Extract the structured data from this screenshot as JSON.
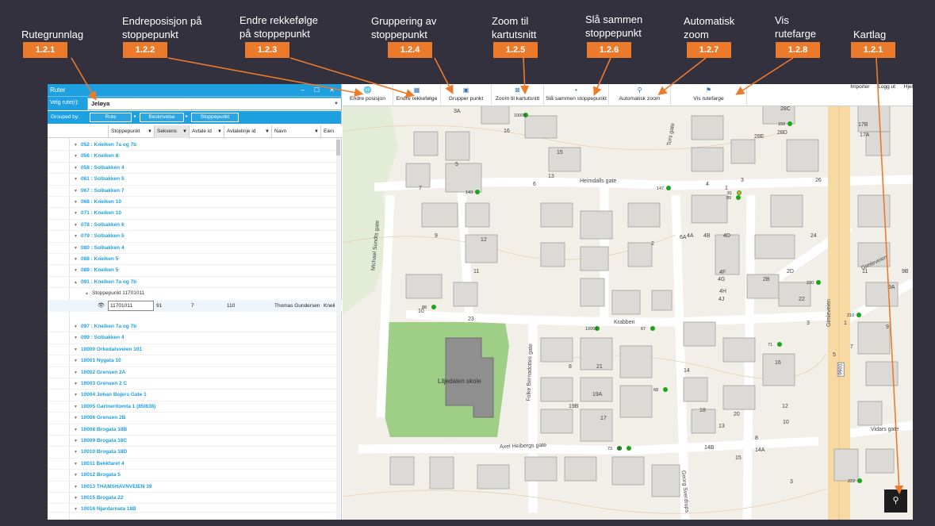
{
  "callouts": [
    {
      "title": "Rutegrunnlag",
      "code": "1.2.1"
    },
    {
      "title": "Endreposisjon på stoppepunkt",
      "code": "1.2.2"
    },
    {
      "title": "Endre rekkefølge på stoppepunkt",
      "code": "1.2.3"
    },
    {
      "title": "Gruppering av stoppepunkt",
      "code": "1.2.4"
    },
    {
      "title": "Zoom til kartutsnitt",
      "code": "1.2.5"
    },
    {
      "title": "Slå sammen stoppepunkt",
      "code": "1.2.6"
    },
    {
      "title": "Automatisk zoom",
      "code": "1.2.7"
    },
    {
      "title": "Vis rutefarge",
      "code": "1.2.8"
    },
    {
      "title": "Kartlag",
      "code": "1.2.1"
    }
  ],
  "panel": {
    "title": "Ruter",
    "window_controls": "– ☐ ✕",
    "route_label": "Velg rute(r):",
    "route_value": "Jeløya",
    "grouped_by_label": "Grouped by:",
    "group_chips": [
      "Rute",
      "Beskrivelse",
      "Stoppepunkt"
    ],
    "columns": [
      "Stoppepunkt",
      "Sekvens",
      "Avtale id",
      "Avtalelinje id",
      "Navn",
      "Eien"
    ],
    "rows_top": [
      "052 : Kneiken 7a og 7b",
      "056 : Kneiken 8",
      "058 : Solbakken 4",
      "061 : Solbakken 5",
      "067 : Solbakken 7",
      "068 : Kneiken 10",
      "071 : Kneiken 10",
      "078 : Solbakken 6",
      "079 : Solbakken 5",
      "080 : Solbakken 4",
      "088 : Kneiken 5",
      "089 : Kneiken 5",
      "091 : Kneiken 7a og 7b"
    ],
    "subgroup": "Stoppepunkt 11701011",
    "detail": {
      "stoppepunkt": "11701011",
      "sekvens": "91",
      "avtale_id": "7",
      "avtalelinje_id": "110",
      "navn": "Thomas Gundersen",
      "eien": "Kneil"
    },
    "rows_bottom": [
      "097 : Kneiken 7a og 7b",
      "099 : Solbakken 4",
      "10000 Orkedalsveien 101",
      "10001 Nygata 10",
      "10002 Grensen 2A",
      "10003 Grensen 2 C",
      "10004 Johan Bojers Gate 1",
      "10005 Gartneritomta 1 (85/838)",
      "10006 Grensen 2B",
      "10008 Brogata 18B",
      "10009 Brogata 18C",
      "10010 Brogata 18D",
      "10011 Bekkfaret 4",
      "10012 Brogata 5",
      "10013 THAMSHAVNVEIEN 39",
      "10015 Brogata 22",
      "10016 Njardarnata 18B"
    ]
  },
  "toolbar": {
    "tools": [
      {
        "label": "Endre posisjon",
        "icon": "🌐"
      },
      {
        "label": "Endre rekkefølge",
        "icon": "▦"
      },
      {
        "label": "Grupper punkt",
        "icon": "▣"
      },
      {
        "label": "Zoom til kartutsnitt",
        "icon": "⊠"
      },
      {
        "label": "Slå sammen stoppepunkt",
        "icon": "•"
      },
      {
        "label": "Automatisk zoom",
        "icon": "⚲"
      },
      {
        "label": "Vis rutefarge",
        "icon": "⚑"
      }
    ],
    "top_right": [
      "Importer",
      "Logg ut",
      "Hjel"
    ]
  },
  "map": {
    "streets": [
      "Heimdalls gate",
      "Krabben",
      "Axel Heibergs gate",
      "Gimleveien",
      "Vidars gate",
      "Michael Sundts gate",
      "Folke Bernadottes gate",
      "Georg Sverdrups",
      "Tors gate",
      "Gimleveien"
    ],
    "school_label": "Liljedalen skole",
    "road_number": "9901",
    "building_numbers": [
      "3A",
      "16",
      "15",
      "5",
      "7",
      "6",
      "13",
      "9",
      "12",
      "11",
      "10",
      "23",
      "21",
      "19A",
      "19B",
      "17",
      "8",
      "4",
      "1",
      "3",
      "2",
      "6A",
      "4A",
      "4B",
      "4D",
      "4F",
      "4G",
      "4H",
      "4J",
      "2B",
      "2D",
      "24",
      "22",
      "26",
      "28D",
      "28C",
      "28E",
      "17B",
      "17A",
      "11",
      "9B",
      "9A",
      "9",
      "7",
      "5",
      "3",
      "1",
      "16",
      "18",
      "20",
      "14",
      "12",
      "10",
      "8",
      "13",
      "15",
      "14B",
      "14A",
      "3"
    ],
    "point_labels": [
      "10005",
      "143",
      "147",
      "91",
      "89",
      "88",
      "10050",
      "67",
      "68",
      "73",
      "80",
      "71",
      "230",
      "210",
      "222",
      "150"
    ],
    "kartlag_icon": "⚲"
  }
}
